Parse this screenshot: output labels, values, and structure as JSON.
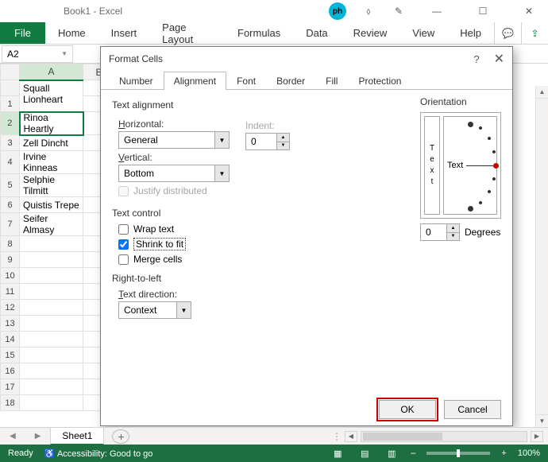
{
  "titlebar": {
    "title": "Book1 - Excel"
  },
  "ribbon": {
    "file": "File",
    "tabs": [
      "Home",
      "Insert",
      "Page Layout",
      "Formulas",
      "Data",
      "Review",
      "View",
      "Help"
    ]
  },
  "namebox": {
    "value": "A2"
  },
  "grid": {
    "columns": [
      "A",
      "B"
    ],
    "rows": [
      {
        "num": "",
        "a": "Squall Lionheart"
      },
      {
        "num": "1",
        "a": ""
      },
      {
        "num": "2",
        "a": "Rinoa Heartly"
      },
      {
        "num": "3",
        "a": "Zell Dincht"
      },
      {
        "num": "4",
        "a": "Irvine Kinneas"
      },
      {
        "num": "5",
        "a": "Selphie Tilmitt"
      },
      {
        "num": "6",
        "a": "Quistis Trepe"
      },
      {
        "num": "7",
        "a": "Seifer Almasy"
      }
    ],
    "active": "A2"
  },
  "dialog": {
    "title": "Format Cells",
    "tabs": [
      "Number",
      "Alignment",
      "Font",
      "Border",
      "Fill",
      "Protection"
    ],
    "active_tab": "Alignment",
    "text_alignment": {
      "section": "Text alignment",
      "horizontal_label": "Horizontal:",
      "horizontal_value": "General",
      "vertical_label": "Vertical:",
      "vertical_value": "Bottom",
      "indent_label": "Indent:",
      "indent_value": "0",
      "justify_label": "Justify distributed"
    },
    "text_control": {
      "section": "Text control",
      "wrap": "Wrap text",
      "shrink": "Shrink to fit",
      "merge": "Merge cells",
      "wrap_checked": false,
      "shrink_checked": true,
      "merge_checked": false
    },
    "rtl": {
      "section": "Right-to-left",
      "direction_label": "Text direction:",
      "direction_value": "Context"
    },
    "orientation": {
      "section": "Orientation",
      "vert_text": "Text",
      "dial_text": "Text",
      "degrees_value": "0",
      "degrees_label": "Degrees"
    },
    "buttons": {
      "ok": "OK",
      "cancel": "Cancel"
    }
  },
  "sheet_tabs": {
    "active": "Sheet1"
  },
  "statusbar": {
    "ready": "Ready",
    "accessibility": "Accessibility: Good to go",
    "zoom": "100%"
  }
}
